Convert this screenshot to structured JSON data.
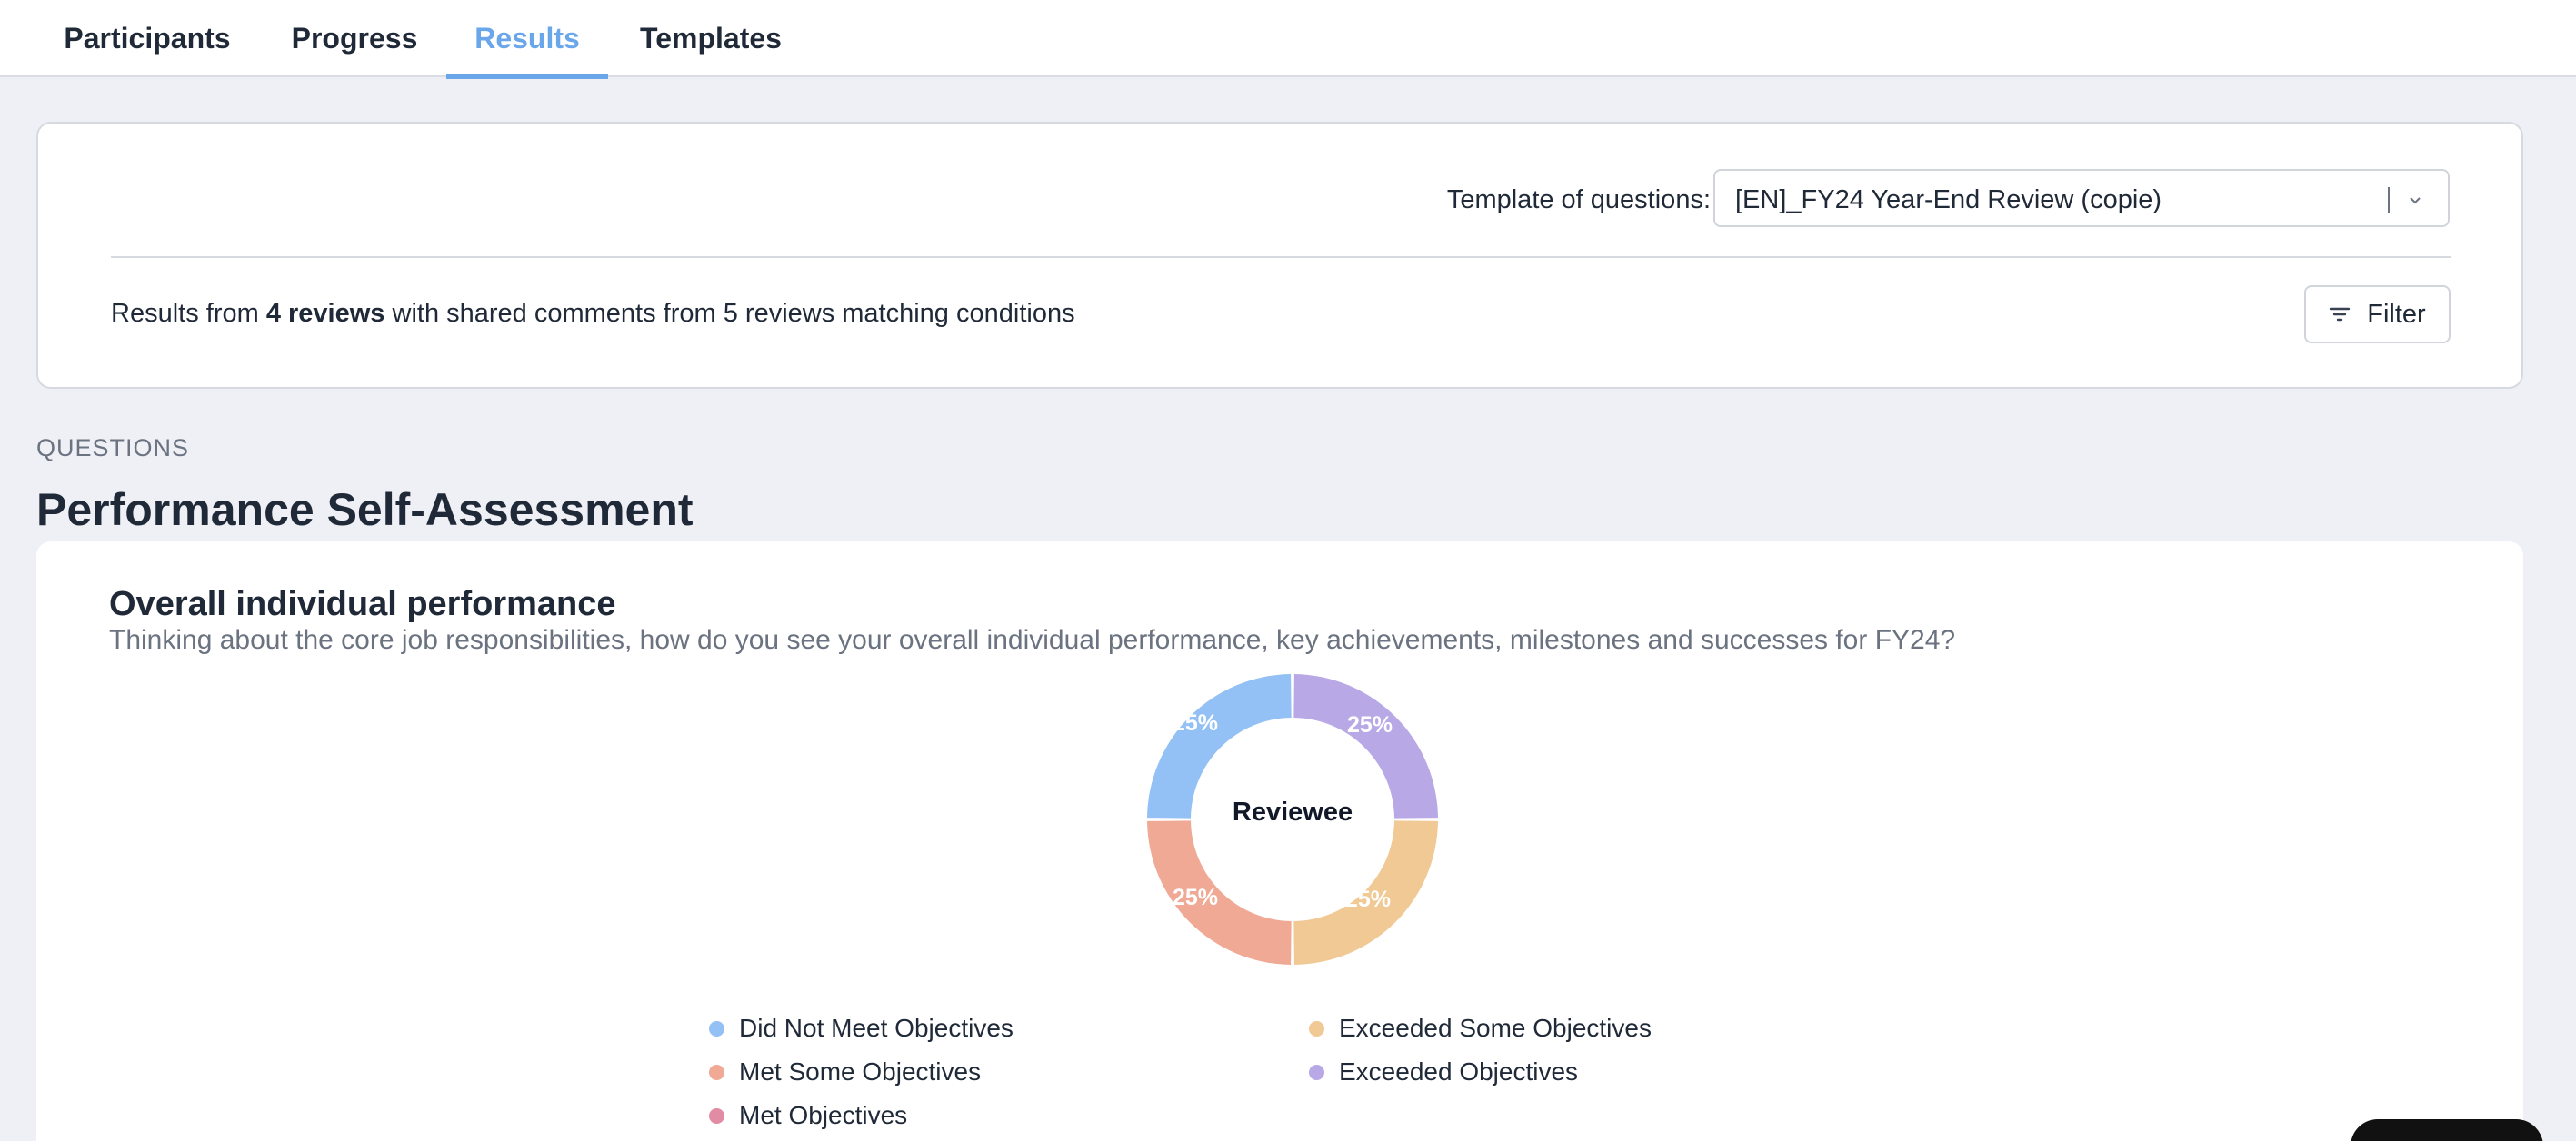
{
  "tabs": [
    {
      "label": "Participants",
      "active": false
    },
    {
      "label": "Progress",
      "active": false
    },
    {
      "label": "Results",
      "active": true
    },
    {
      "label": "Templates",
      "active": false
    }
  ],
  "template": {
    "label": "Template of questions:",
    "value": "[EN]_FY24 Year-End Review (copie)"
  },
  "results": {
    "prefix": "Results from ",
    "bold": "4 reviews",
    "suffix": " with shared comments from 5 reviews matching conditions"
  },
  "filter_label": "Filter",
  "questions_label": "QUESTIONS",
  "section_title": "Performance Self-Assessment",
  "question": {
    "title": "Overall individual performance",
    "description": "Thinking about the core job responsibilities, how do you see your overall individual performance, key achievements, milestones and successes for FY24?"
  },
  "chart_data": {
    "type": "pie",
    "center_label": "Reviewee",
    "slices": [
      {
        "label": "Did Not Meet Objectives",
        "value": 25,
        "color": "#93c0f5"
      },
      {
        "label": "Met Some Objectives",
        "value": 25,
        "color": "#f0a994"
      },
      {
        "label": "Exceeded Some Objectives",
        "value": 25,
        "color": "#f0c994"
      },
      {
        "label": "Exceeded Objectives",
        "value": 25,
        "color": "#b8a9e6"
      }
    ],
    "data_labels": [
      "25%",
      "25%",
      "25%",
      "25%"
    ],
    "legend": [
      {
        "label": "Did Not Meet Objectives",
        "color": "#93c0f5"
      },
      {
        "label": "Met Some Objectives",
        "color": "#f0a994"
      },
      {
        "label": "Met Objectives",
        "color": "#e28ba4"
      },
      {
        "label": "Exceeded Some Objectives",
        "color": "#f0c994"
      },
      {
        "label": "Exceeded Objectives",
        "color": "#b8a9e6"
      }
    ],
    "legend_position": "bottom"
  },
  "colors": {
    "accent": "#6aa6ea",
    "background": "#eff0f5"
  }
}
